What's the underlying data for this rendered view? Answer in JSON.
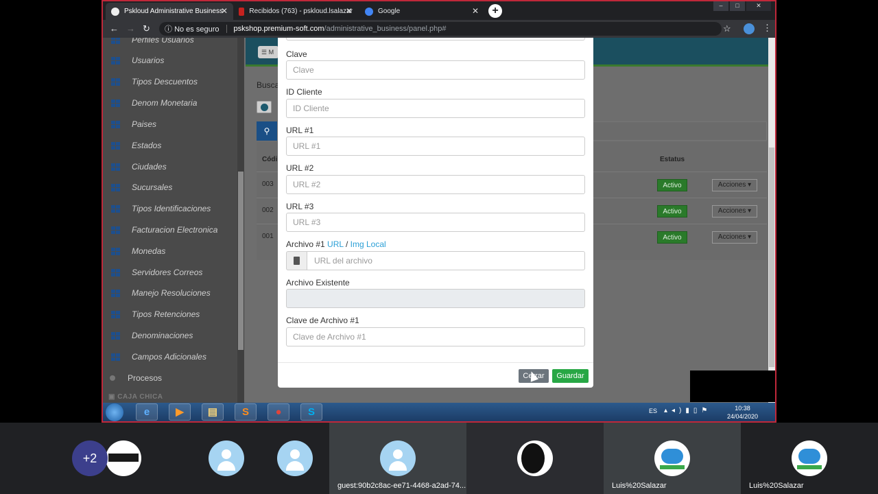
{
  "browser": {
    "tabs": [
      {
        "label": "Pskloud Administrative Business",
        "active": true
      },
      {
        "label": "Recibidos (763) - pskloud.lsalazar",
        "active": false
      },
      {
        "label": "Google",
        "active": false
      }
    ],
    "security": "No es seguro",
    "url_host": "pskshop.premium-soft.com",
    "url_path": "/administrative_business/panel.php#"
  },
  "sidebar": {
    "items": [
      {
        "label": "Perfiles Usuarios"
      },
      {
        "label": "Usuarios"
      },
      {
        "label": "Tipos Descuentos"
      },
      {
        "label": "Denom Monetaria"
      },
      {
        "label": "Paises"
      },
      {
        "label": "Estados"
      },
      {
        "label": "Ciudades"
      },
      {
        "label": "Sucursales"
      },
      {
        "label": "Tipos Identificaciones"
      },
      {
        "label": "Facturacion Electronica"
      },
      {
        "label": "Monedas"
      },
      {
        "label": "Servidores Correos"
      },
      {
        "label": "Manejo Resoluciones"
      },
      {
        "label": "Tipos Retenciones"
      },
      {
        "label": "Denominaciones"
      },
      {
        "label": "Campos Adicionales"
      }
    ],
    "procesos": "Procesos",
    "section": "CAJA CHICA"
  },
  "page": {
    "menu_label": "M",
    "busca": "Busca",
    "col_code": "Códi",
    "col_status": "Estatus",
    "rows": [
      {
        "code": "003",
        "status": "Activo",
        "actions": "Acciones"
      },
      {
        "code": "002",
        "status": "Activo",
        "actions": "Acciones"
      },
      {
        "code": "001",
        "status": "Activo",
        "actions": "Acciones"
      }
    ]
  },
  "modal": {
    "fields": [
      {
        "label": "Clave",
        "placeholder": "Clave"
      },
      {
        "label": "ID Cliente",
        "placeholder": "ID Cliente"
      },
      {
        "label": "URL #1",
        "placeholder": "URL #1"
      },
      {
        "label": "URL #2",
        "placeholder": "URL #2"
      },
      {
        "label": "URL #3",
        "placeholder": "URL #3"
      }
    ],
    "archivo_label": "Archivo #1",
    "archivo_url_link": "URL",
    "archivo_sep": "/",
    "archivo_img_link": "Img Local",
    "archivo_placeholder": "URL del archivo",
    "existente_label": "Archivo Existente",
    "clave_archivo_label": "Clave de Archivo #1",
    "clave_archivo_placeholder": "Clave de Archivo #1",
    "btn_cerrar": "Cerrar",
    "btn_guardar": "Guardar"
  },
  "taskbar": {
    "lang": "ES",
    "time": "10:38",
    "date": "24/04/2020"
  },
  "meeting": {
    "more_count": "+2",
    "participants": [
      {
        "name": ""
      },
      {
        "name": ""
      },
      {
        "name": ""
      },
      {
        "name": "guest:90b2c8ac-ee71-4468-a2ad-74..."
      },
      {
        "name": ""
      },
      {
        "name": "Luis%20Salazar"
      },
      {
        "name": "Luis%20Salazar"
      }
    ]
  }
}
